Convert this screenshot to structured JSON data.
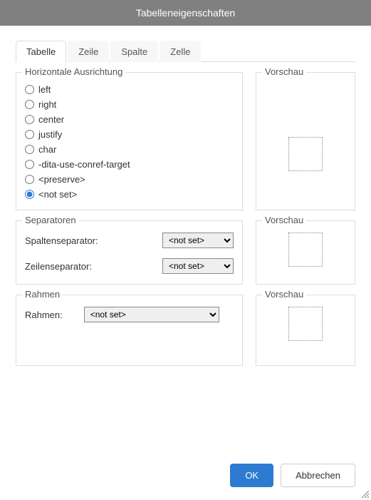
{
  "dialog": {
    "title": "Tabelleneigenschaften"
  },
  "tabs": {
    "tabelle": "Tabelle",
    "zeile": "Zeile",
    "spalte": "Spalte",
    "zelle": "Zelle"
  },
  "halign": {
    "legend": "Horizontale Ausrichtung",
    "options": {
      "left": "left",
      "right": "right",
      "center": "center",
      "justify": "justify",
      "char": "char",
      "dita": "-dita-use-conref-target",
      "preserve": "<preserve>",
      "notset": "<not set>"
    }
  },
  "preview_label": "Vorschau",
  "separators": {
    "legend": "Separatoren",
    "col_label": "Spaltenseparator:",
    "row_label": "Zeilenseparator:",
    "col_value": "<not set>",
    "row_value": "<not set>"
  },
  "frame": {
    "legend": "Rahmen",
    "label": "Rahmen:",
    "value": "<not set>"
  },
  "buttons": {
    "ok": "OK",
    "cancel": "Abbrechen"
  }
}
